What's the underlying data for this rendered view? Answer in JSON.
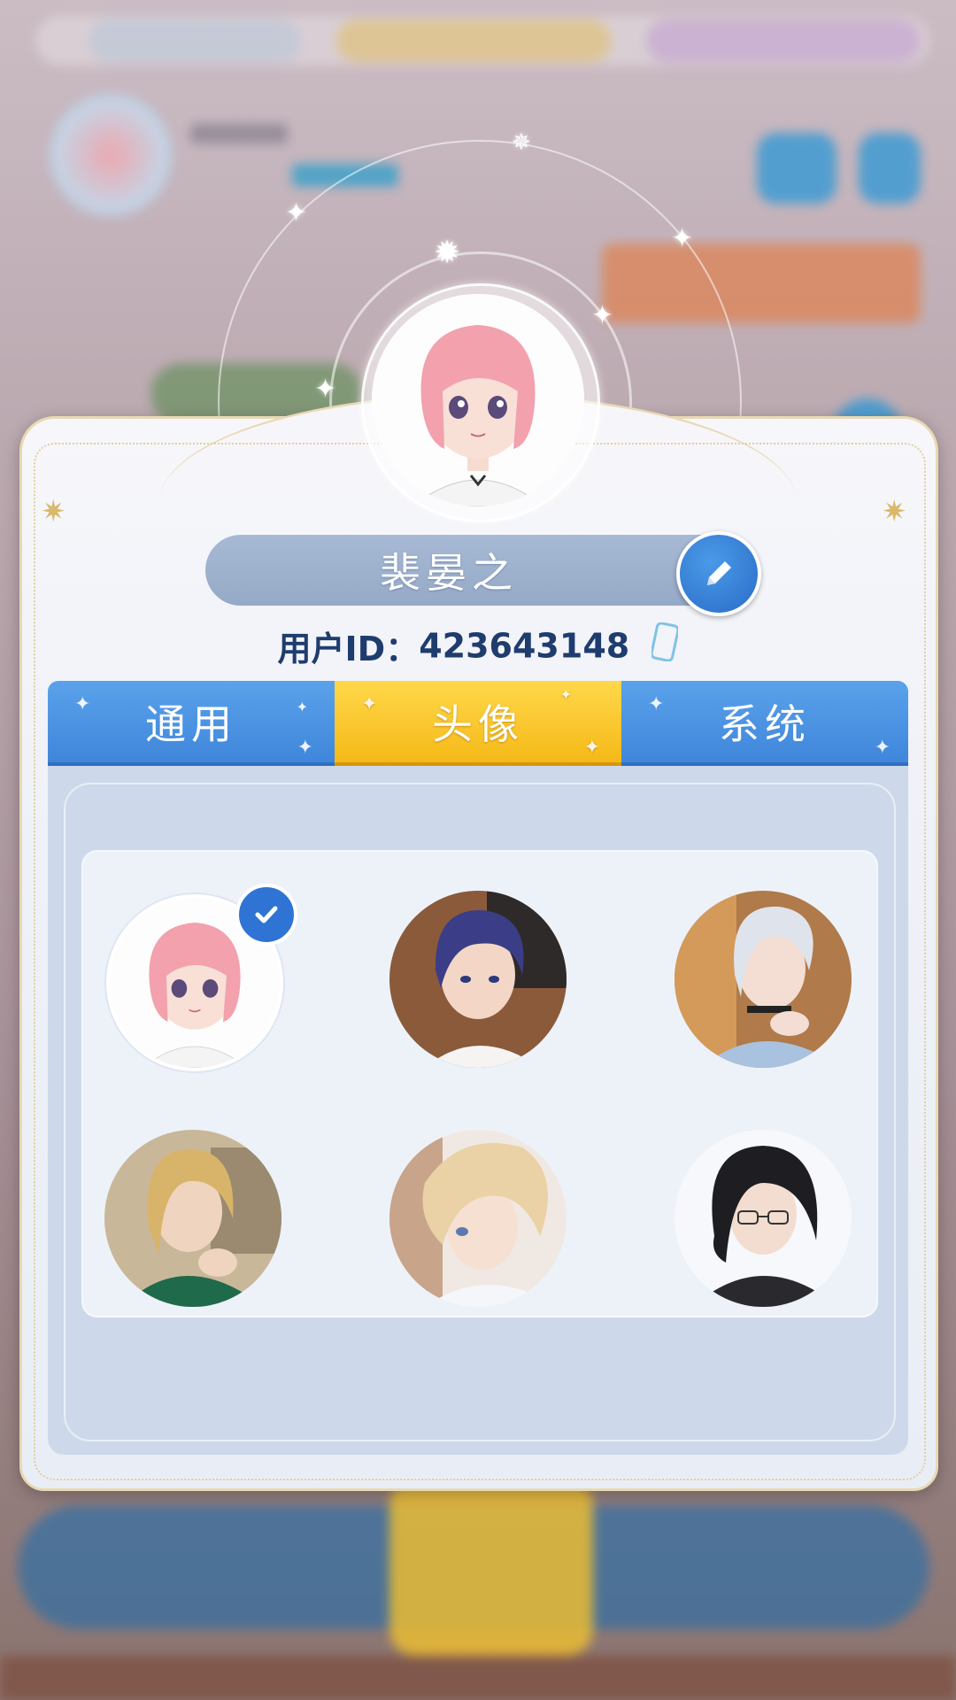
{
  "profile": {
    "name": "裴晏之",
    "uid_label": "用户ID：",
    "uid_value": "423643148"
  },
  "tabs": [
    {
      "label": "通用",
      "active": false
    },
    {
      "label": "头像",
      "active": true
    },
    {
      "label": "系统",
      "active": false
    }
  ],
  "avatars": [
    {
      "name": "pink-hair-girl",
      "selected": true
    },
    {
      "name": "blue-hair-man",
      "selected": false
    },
    {
      "name": "silver-hair-man",
      "selected": false
    },
    {
      "name": "blond-hair-man",
      "selected": false
    },
    {
      "name": "light-blond-man",
      "selected": false
    },
    {
      "name": "black-hair-glasses-man",
      "selected": false
    }
  ],
  "colors": {
    "tab_blue": "#4a94e2",
    "tab_active_yellow": "#f7c52b",
    "check_blue": "#2f74d4",
    "uid_text": "#1f3c6e"
  },
  "icons": {
    "edit": "pencil-icon",
    "copy": "phone-copy-icon",
    "selected": "checkmark-icon"
  }
}
